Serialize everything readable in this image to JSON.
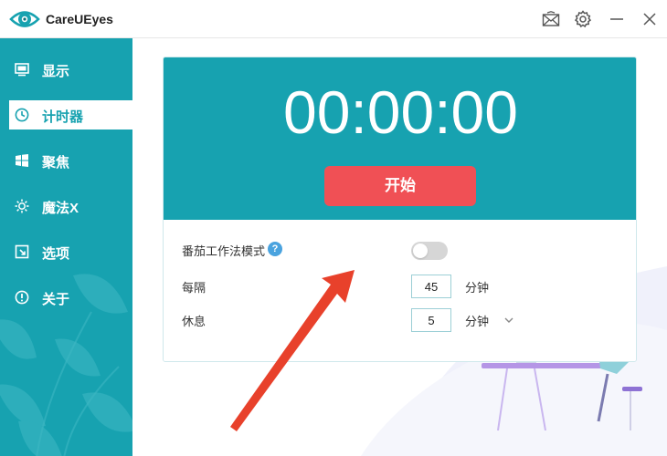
{
  "app": {
    "title": "CareUEyes"
  },
  "sidebar": {
    "items": [
      {
        "label": "显示",
        "icon": "monitor-icon"
      },
      {
        "label": "计时器",
        "icon": "clock-icon",
        "active": true
      },
      {
        "label": "聚焦",
        "icon": "windows-icon"
      },
      {
        "label": "魔法X",
        "icon": "sun-icon"
      },
      {
        "label": "选项",
        "icon": "options-icon"
      },
      {
        "label": "关于",
        "icon": "info-icon"
      }
    ]
  },
  "timer": {
    "display": "00:00:00",
    "start_label": "开始"
  },
  "settings": {
    "pomodoro_label": "番茄工作法模式",
    "help_glyph": "?",
    "pomodoro_enabled": false,
    "every_label": "每隔",
    "every_value": "45",
    "every_unit": "分钟",
    "rest_label": "休息",
    "rest_value": "5",
    "rest_unit": "分钟"
  },
  "colors": {
    "accent": "#17a2b0",
    "start_button": "#f05055",
    "annotation_arrow": "#e8412b"
  }
}
